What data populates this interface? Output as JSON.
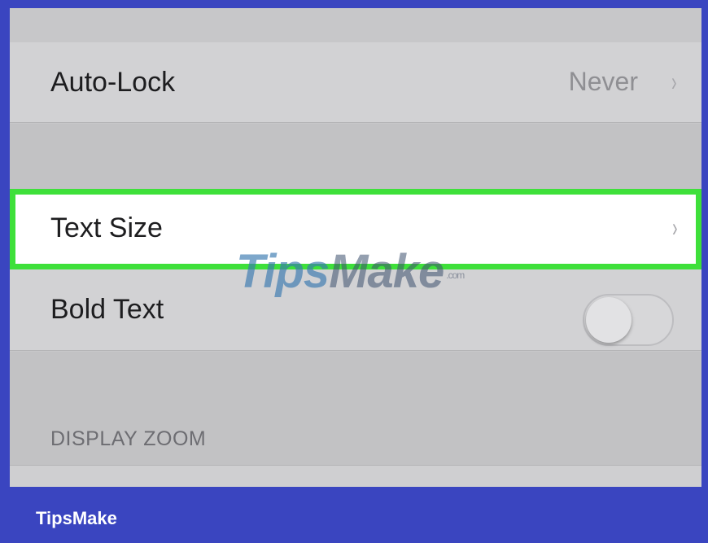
{
  "settings": {
    "auto_lock": {
      "label": "Auto-Lock",
      "value": "Never",
      "chevron": "›"
    },
    "text_size": {
      "label": "Text Size",
      "chevron": "›",
      "highlight_color": "#3ee03a"
    },
    "bold_text": {
      "label": "Bold Text",
      "toggle_on": false
    },
    "display_zoom": {
      "header": "DISPLAY ZOOM"
    }
  },
  "watermark": {
    "text_first": "Tips",
    "text_second": "Make",
    "suffix": ".com"
  },
  "footer": {
    "brand": "TipsMake",
    "background_color": "#3a45c0"
  }
}
